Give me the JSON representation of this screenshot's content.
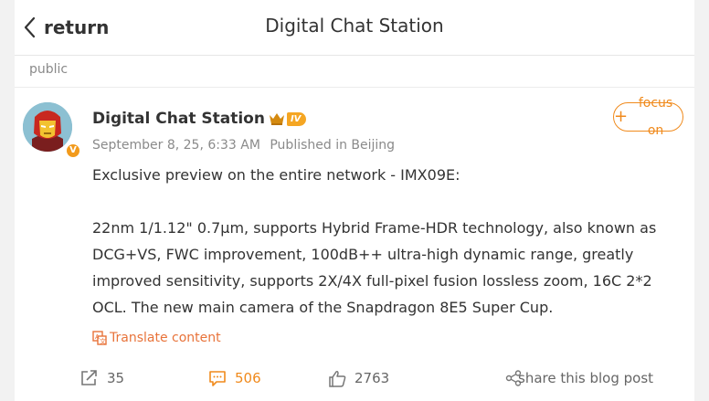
{
  "header": {
    "back_label": "return",
    "title": "Digital Chat Station"
  },
  "section_label": "public",
  "post": {
    "author": "Digital Chat Station",
    "level_badge": "IV",
    "date": "September 8, 25, 6:33 AM",
    "location": "Published in Beijing",
    "follow_label": "focus on",
    "follow_plus": "+",
    "paragraphs": [
      "Exclusive preview on the entire network - IMX09E:",
      "22nm 1/1.12\" 0.7μm, supports Hybrid Frame-HDR technology, also known as DCG+VS, FWC improvement, 100dB++ ultra-high dynamic range, greatly improved sensitivity, supports 2X/4X full-pixel fusion lossless zoom, 16C 2*2 OCL. The new main camera of the Snapdragon 8E5 Super Cup."
    ],
    "translate_label": "Translate content"
  },
  "actions": {
    "forward_count": "35",
    "comment_count": "506",
    "like_count": "2763",
    "share_label": "share this blog post"
  },
  "colors": {
    "accent": "#f08a1c",
    "translate": "#e8733a",
    "badge": "#f5a623",
    "muted_text": "#8a8a8a"
  }
}
